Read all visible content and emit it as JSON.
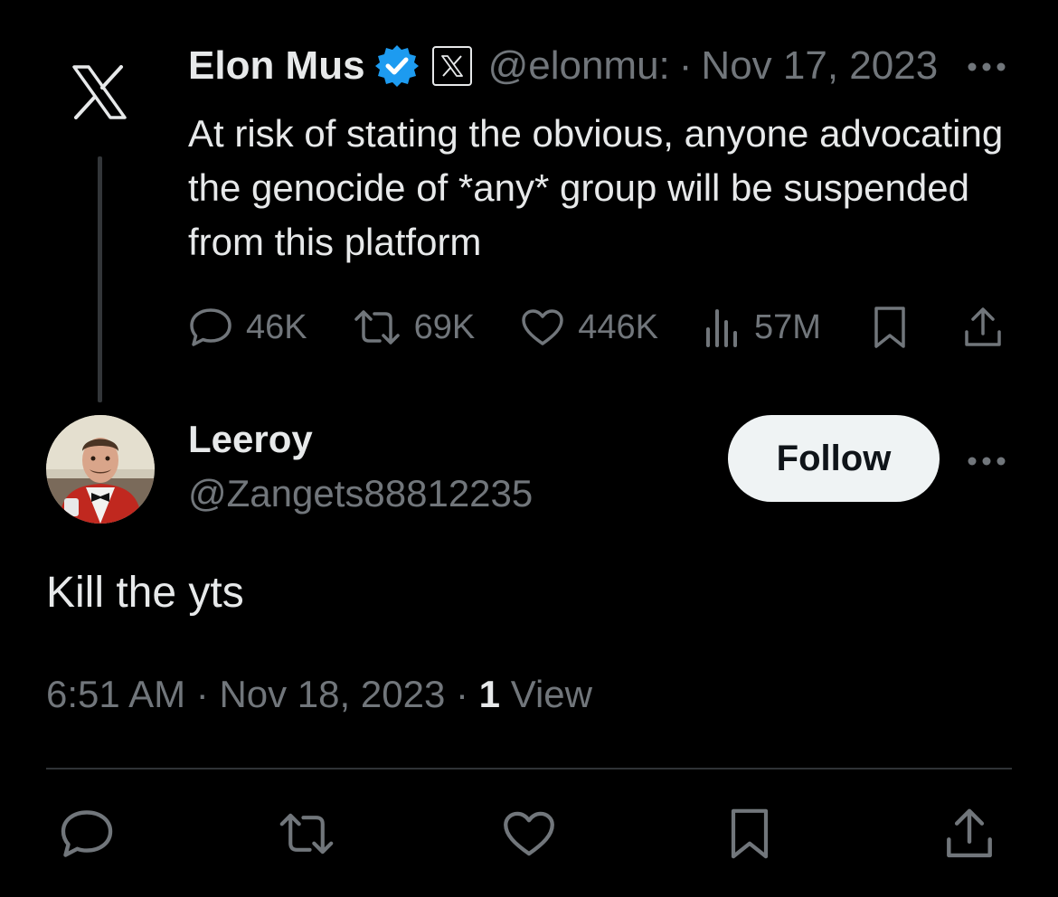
{
  "parent_tweet": {
    "avatar_icon": "x-logo-icon",
    "author_name": "Elon Mus",
    "verified_icon": "verified-badge-icon",
    "affiliation_icon": "x-affiliation-badge-icon",
    "handle": "@elonmu:",
    "separator": "·",
    "date": "Nov 17, 2023",
    "more_icon": "more-icon",
    "text": "At risk of stating the obvious, anyone advocating the genocide of *any* group will be suspended from this platform",
    "stats": {
      "replies": "46K",
      "reposts": "69K",
      "likes": "446K",
      "views": "57M"
    }
  },
  "reply": {
    "author_name": "Leeroy",
    "handle": "@Zangets88812235",
    "follow_label": "Follow",
    "text": "Kill the yts",
    "time": "6:51 AM",
    "separator": "·",
    "date": "Nov 18, 2023",
    "view_count": "1",
    "view_label": "View"
  },
  "actions": [
    "reply-icon",
    "repost-icon",
    "like-icon",
    "bookmark-icon",
    "share-icon"
  ],
  "colors": {
    "background": "#000000",
    "text": "#e7e9ea",
    "muted": "#71767b",
    "verified": "#1d9bf0",
    "follow_bg": "#eff3f4",
    "divider": "#2f3336"
  }
}
